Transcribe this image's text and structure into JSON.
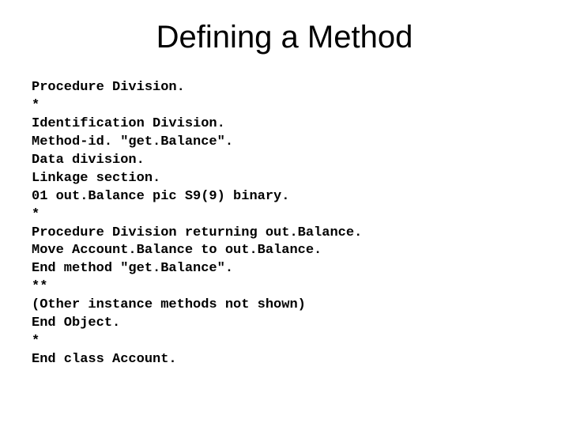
{
  "title": "Defining a Method",
  "code": "Procedure Division.\n*\nIdentification Division.\nMethod-id. \"get.Balance\".\nData division.\nLinkage section.\n01 out.Balance pic S9(9) binary.\n*\nProcedure Division returning out.Balance.\nMove Account.Balance to out.Balance.\nEnd method \"get.Balance\".\n**\n(Other instance methods not shown)\nEnd Object.\n*\nEnd class Account."
}
